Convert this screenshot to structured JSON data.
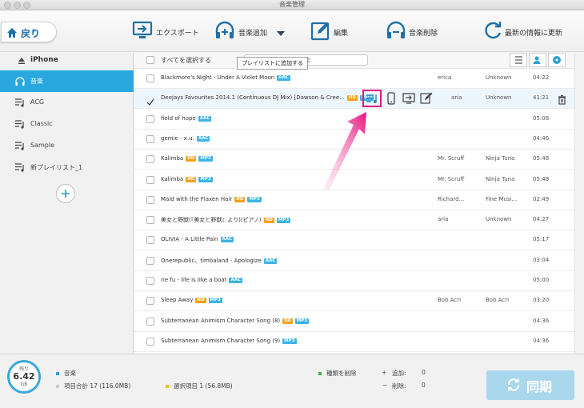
{
  "window": {
    "title": "音楽管理"
  },
  "toolbar": {
    "back_label": "戻り",
    "export_label": "エクスポート",
    "add_label": "音楽追加",
    "edit_label": "編集",
    "delete_label": "音楽削除",
    "refresh_label": "最新の情報に更新"
  },
  "sidebar": {
    "device_name": "iPhone",
    "items": [
      {
        "label": "音楽",
        "active": true
      },
      {
        "label": "ACG"
      },
      {
        "label": "Classic"
      },
      {
        "label": "Sample"
      },
      {
        "label": "新プレイリスト_1"
      }
    ]
  },
  "list": {
    "select_all_label": "すべてを選択する",
    "search_placeholder": "検索",
    "rows": [
      {
        "title": "Blackmore's Night - Under A Violet Moon",
        "badges": [
          "AAC"
        ],
        "artist": "erica",
        "album": "Unknown",
        "time": "04:22",
        "checked": false
      },
      {
        "title": "Deejays Favourites 2014.1 (Continuous DJ Mix) [Dawson & Cree...",
        "badges": [
          "HD",
          "MP3"
        ],
        "artist": "aria",
        "album": "Unknown",
        "time": "41:21",
        "checked": true
      },
      {
        "title": "field of hope",
        "badges": [
          "AAC"
        ],
        "artist": "",
        "album": "",
        "time": "05:08",
        "checked": false
      },
      {
        "title": "gemie - x.u.",
        "badges": [
          "AAC"
        ],
        "artist": "",
        "album": "",
        "time": "04:46",
        "checked": false
      },
      {
        "title": "Kalimba",
        "badges": [
          "HD",
          "MP3"
        ],
        "artist": "Mr. Scruff",
        "album": "Ninja Tuna",
        "time": "05:48",
        "checked": false
      },
      {
        "title": "Kalimba",
        "badges": [
          "HD",
          "MP3"
        ],
        "artist": "Mr. Scruff",
        "album": "Ninja Tuna",
        "time": "05:48",
        "checked": false
      },
      {
        "title": "Maid with the Flaxen Hair",
        "badges": [
          "HD",
          "MP3"
        ],
        "artist": "Richard...",
        "album": "Fine Musi...",
        "time": "02:49",
        "checked": false
      },
      {
        "title": "美女と野獣(『美女と野獣』より)(ピアノ)",
        "badges": [
          "HD",
          "MP3"
        ],
        "artist": "aria",
        "album": "Unknown",
        "time": "04:27",
        "checked": false
      },
      {
        "title": "OLIVIA - A Little Pain",
        "badges": [
          "AAC"
        ],
        "artist": "",
        "album": "",
        "time": "05:17",
        "checked": false
      },
      {
        "title": "Onerepublic、timbaland - Apologize",
        "badges": [
          "AAC"
        ],
        "artist": "",
        "album": "",
        "time": "03:04",
        "checked": false
      },
      {
        "title": "rie fu - life is like a boat",
        "badges": [
          "AAC"
        ],
        "artist": "",
        "album": "",
        "time": "05:00",
        "checked": false
      },
      {
        "title": "Sleep Away",
        "badges": [
          "HD",
          "MP3"
        ],
        "artist": "Bob Acri",
        "album": "Bob Acri",
        "time": "03:20",
        "checked": false
      },
      {
        "title": "Subterranean Animism Character Song (8)",
        "badges": [
          "SD",
          "MP3"
        ],
        "artist": "",
        "album": "",
        "time": "04:36",
        "checked": false
      },
      {
        "title": "Subterranean Animism Character Song (9)",
        "badges": [
          "MP3"
        ],
        "artist": "",
        "album": "",
        "time": "04:36",
        "checked": false
      }
    ]
  },
  "tooltip": {
    "text": "プレイリストに追加する"
  },
  "footer": {
    "remaining_label": "残り",
    "remaining_value": "6.42",
    "remaining_unit": "GB",
    "legend_music": "音楽",
    "total_items": "項目合計 17 (116.0MB)",
    "selected_items": "選択項目 1 (56.8MB)",
    "legend_delete": "種類を削除",
    "added_label": "追加:",
    "added_value": "0",
    "removed_label": "削除:",
    "removed_value": "0",
    "sync_label": "同期"
  },
  "colors": {
    "accent": "#29a8e0",
    "highlight": "#e8127e",
    "hd_badge": "#f4a21a",
    "aac_badge": "#3fb3e6"
  }
}
